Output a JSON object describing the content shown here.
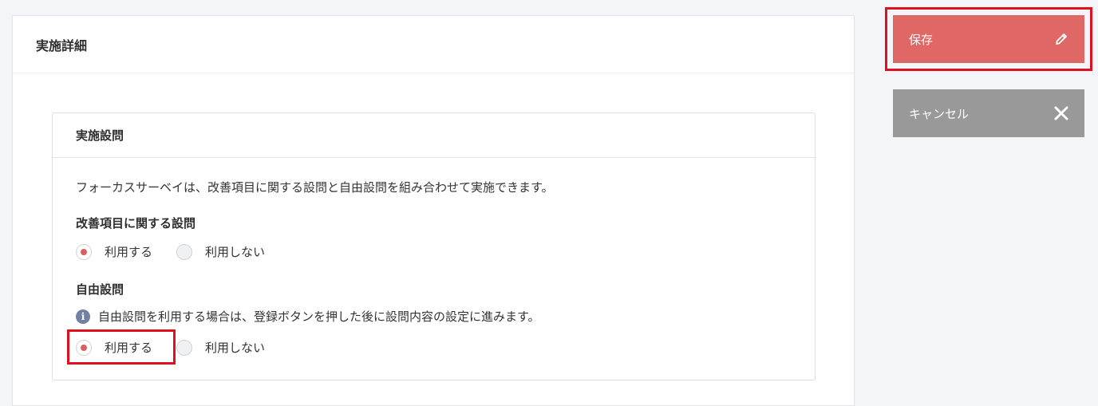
{
  "card": {
    "title": "実施詳細"
  },
  "panel": {
    "title": "実施設問",
    "description": "フォーカスサーベイは、改善項目に関する設問と自由設問を組み合わせて実施できます。",
    "improvement": {
      "title": "改善項目に関する設問",
      "option_use": "利用する",
      "option_not_use": "利用しない",
      "selected": "use"
    },
    "free": {
      "title": "自由設問",
      "note": "自由設問を利用する場合は、登録ボタンを押した後に設問内容の設定に進みます。",
      "option_use": "利用する",
      "option_not_use": "利用しない",
      "selected": "use"
    }
  },
  "actions": {
    "save_label": "保存",
    "cancel_label": "キャンセル"
  },
  "colors": {
    "accent": "#df6867",
    "radio_dot": "#de5d5d",
    "cancel": "#999999",
    "highlight": "#e0101e"
  },
  "icons": {
    "save": "pencil-icon",
    "cancel": "close-icon",
    "note": "info-icon"
  }
}
